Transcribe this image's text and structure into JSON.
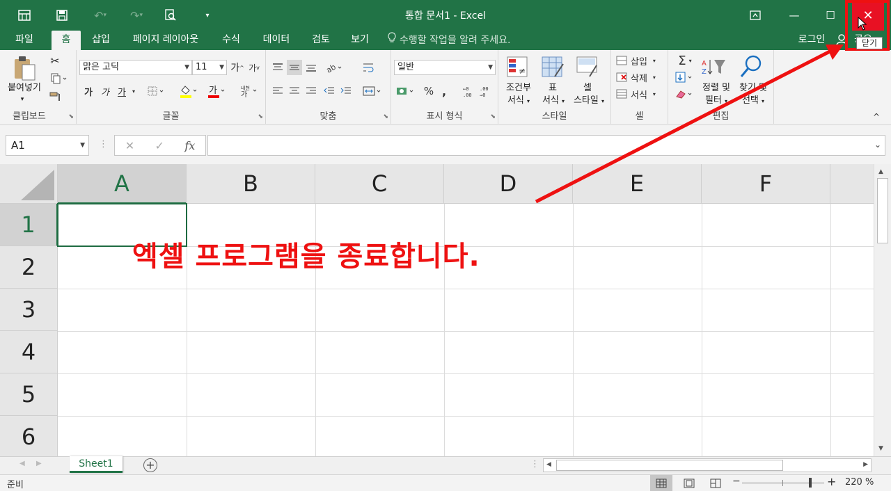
{
  "window": {
    "title": "통합 문서1 - Excel",
    "close_tooltip": "닫기",
    "minimize_glyph": "—",
    "restore_glyph": "☐",
    "close_glyph": "✕"
  },
  "tabs": [
    {
      "label": "파일"
    },
    {
      "label": "홈",
      "active": true
    },
    {
      "label": "삽입"
    },
    {
      "label": "페이지 레이아웃"
    },
    {
      "label": "수식"
    },
    {
      "label": "데이터"
    },
    {
      "label": "검토"
    },
    {
      "label": "보기"
    }
  ],
  "tellme": "수행할 작업을 알려 주세요.",
  "account": {
    "login": "로그인",
    "share": "공유"
  },
  "ribbon": {
    "clipboard": {
      "label": "클립보드",
      "paste": "붙여넣기"
    },
    "font": {
      "label": "글꼴",
      "name": "맑은 고딕",
      "size": "11",
      "bold": "가",
      "italic": "가",
      "underline": "가",
      "grow": "가",
      "shrink": "가"
    },
    "alignment": {
      "label": "맞춤"
    },
    "number": {
      "label": "표시 형식",
      "format": "일반",
      "percent": "%",
      "comma": ","
    },
    "styles": {
      "label": "스타일",
      "conditional": [
        "조건부",
        "서식"
      ],
      "table": [
        "표",
        "서식"
      ],
      "cell": [
        "셀",
        "스타일"
      ]
    },
    "cells": {
      "label": "셀",
      "insert": "삽입",
      "delete": "삭제",
      "format": "서식"
    },
    "editing": {
      "label": "편집",
      "sort": [
        "정렬 및",
        "필터"
      ],
      "find": [
        "찾기 및",
        "선택"
      ]
    }
  },
  "formula_bar": {
    "name_box": "A1",
    "fx": "fx",
    "cancel": "✕",
    "enter": "✓"
  },
  "sheet": {
    "columns": [
      "A",
      "B",
      "C",
      "D",
      "E",
      "F"
    ],
    "rows": [
      "1",
      "2",
      "3",
      "4",
      "5",
      "6"
    ],
    "active_cell": "A1"
  },
  "annotation": "엑셀 프로그램을 종료합니다.",
  "sheet_tabs": [
    {
      "label": "Sheet1",
      "active": true
    }
  ],
  "status": {
    "ready": "준비",
    "zoom": "220 %",
    "zoom_level": 0.83
  },
  "colors": {
    "accent": "#217346",
    "annotation": "#ee1111"
  }
}
